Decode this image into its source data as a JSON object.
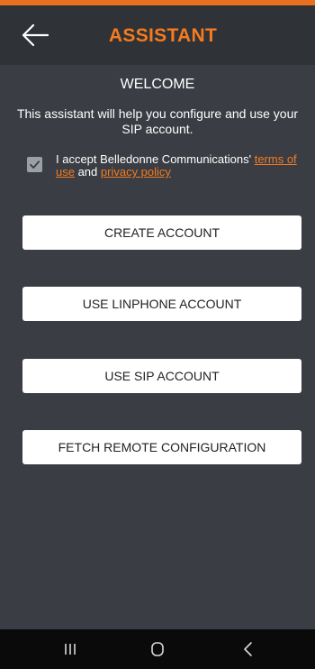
{
  "header": {
    "title": "ASSISTANT",
    "back_icon": "arrow-left-icon"
  },
  "welcome": {
    "heading": "WELCOME",
    "description": "This assistant will help you configure and use your SIP account."
  },
  "terms": {
    "checked": true,
    "text_before": "I accept Belledonne Communications' ",
    "terms_link": "terms of use",
    "text_middle": " and ",
    "privacy_link": "privacy policy"
  },
  "buttons": {
    "create_account": "CREATE ACCOUNT",
    "use_linphone_account": "USE LINPHONE ACCOUNT",
    "use_sip_account": "USE SIP ACCOUNT",
    "fetch_remote_configuration": "FETCH REMOTE CONFIGURATION"
  },
  "navigation": {
    "recent_apps_icon": "recent-apps-icon",
    "home_icon": "home-icon",
    "back_icon": "back-chevron-icon"
  },
  "colors": {
    "accent": "#f47b20",
    "background": "#3a3d43",
    "header_background": "#2f3237"
  }
}
